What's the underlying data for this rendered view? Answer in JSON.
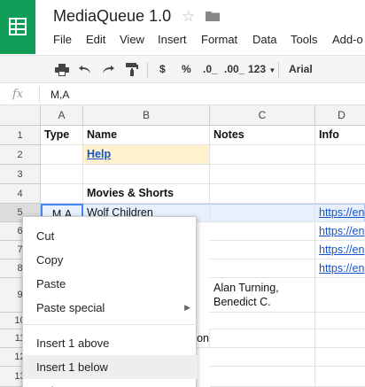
{
  "app": {
    "title": "MediaQueue 1.0",
    "menu": [
      "File",
      "Edit",
      "View",
      "Insert",
      "Format",
      "Data",
      "Tools",
      "Add-o"
    ]
  },
  "toolbar": {
    "currency": "$",
    "percent": "%",
    "dec_less": ".0_",
    "dec_more": ".00_",
    "format_num": "123",
    "font": "Arial"
  },
  "formula_bar": {
    "fx": "fx",
    "value": "M,A"
  },
  "grid": {
    "columns": [
      "A",
      "B",
      "C",
      "D"
    ],
    "rows": [
      "1",
      "2",
      "3",
      "4",
      "5",
      "6",
      "7",
      "8",
      "9",
      "10",
      "11",
      "12",
      "13"
    ],
    "cells": {
      "a1": "Type",
      "b1": "Name",
      "c1": "Notes",
      "d1": "Info",
      "b2": "Help",
      "b4": "Movies & Shorts",
      "a5": "M,A",
      "b5": "Wolf Children",
      "d5": "https://en",
      "d6": "https://en",
      "d7": "https://en",
      "d8": "https://en",
      "c9": "Alan Turning, Benedict C.",
      "b11": "agon"
    }
  },
  "context_menu": {
    "items": [
      "Cut",
      "Copy",
      "Paste",
      "Paste special",
      "Insert 1 above",
      "Insert 1 below",
      "Delete row"
    ]
  },
  "colors": {
    "brand": "#0f9d58",
    "link": "#1155cc",
    "help_bg": "#fff2cc",
    "selection": "#4285f4"
  }
}
